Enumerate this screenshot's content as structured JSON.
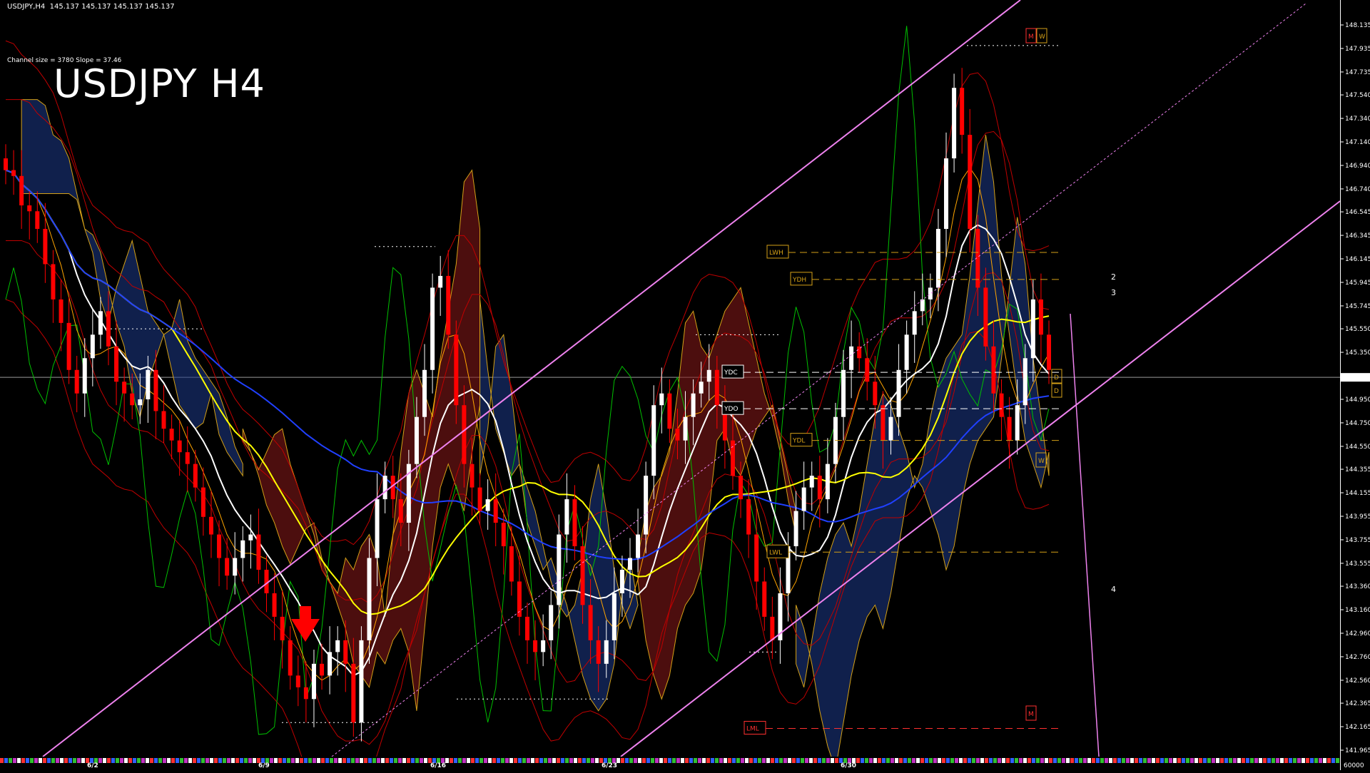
{
  "header": {
    "symbol_info": "USDJPY,H4",
    "ohlc": "145.137 145.137 145.137 145.137",
    "channel_info": "Channel size = 3780  Slope = 37.46",
    "title": "USDJPY H4"
  },
  "chart_data": {
    "type": "candlestick",
    "title": "USDJPY H4",
    "timeframe": "H4",
    "current_price": "145.137",
    "y_axis": {
      "min": 141.965,
      "max": 148.135,
      "ticks": [
        "148.135",
        "147.935",
        "147.735",
        "147.540",
        "147.340",
        "147.140",
        "146.940",
        "146.740",
        "146.545",
        "146.345",
        "146.145",
        "145.945",
        "145.745",
        "145.550",
        "145.350",
        "145.150",
        "144.950",
        "144.750",
        "144.550",
        "144.355",
        "144.155",
        "143.955",
        "143.755",
        "143.555",
        "143.360",
        "143.160",
        "142.960",
        "142.760",
        "142.560",
        "142.365",
        "142.165",
        "141.965"
      ],
      "bottom_label": "60000"
    },
    "x_axis": {
      "date_labels": [
        "6/2",
        "6/9",
        "6/16",
        "6/23",
        "6/30"
      ]
    },
    "candles_close_path": [
      146.9,
      146.85,
      146.6,
      146.55,
      146.4,
      146.1,
      145.8,
      145.6,
      145.2,
      145.0,
      145.3,
      145.5,
      145.7,
      145.4,
      145.1,
      145.0,
      144.9,
      144.95,
      145.2,
      144.85,
      144.7,
      144.6,
      144.5,
      144.4,
      144.2,
      143.95,
      143.8,
      143.6,
      143.45,
      143.6,
      143.75,
      143.8,
      143.5,
      143.3,
      143.1,
      142.9,
      142.6,
      142.5,
      142.4,
      142.7,
      142.6,
      142.8,
      142.9,
      142.7,
      142.2,
      142.9,
      143.6,
      144.1,
      144.3,
      144.1,
      143.9,
      144.4,
      144.8,
      145.2,
      145.9,
      146.0,
      145.5,
      144.9,
      144.4,
      144.2,
      144.0,
      144.1,
      143.9,
      143.7,
      143.4,
      143.1,
      142.9,
      142.8,
      142.9,
      143.2,
      143.8,
      144.1,
      143.7,
      143.2,
      142.9,
      142.7,
      142.9,
      143.3,
      143.5,
      143.6,
      143.8,
      144.3,
      144.9,
      145.0,
      144.7,
      144.6,
      144.8,
      145.0,
      145.1,
      145.2,
      144.9,
      144.6,
      144.3,
      144.1,
      143.8,
      143.4,
      143.1,
      142.9,
      143.3,
      143.7,
      144.0,
      144.2,
      144.3,
      144.1,
      144.4,
      144.8,
      145.2,
      145.4,
      145.3,
      145.1,
      144.9,
      144.6,
      144.8,
      145.2,
      145.5,
      145.7,
      145.8,
      145.9,
      146.4,
      147.0,
      147.6,
      147.2,
      146.4,
      145.9,
      145.4,
      145.0,
      144.8,
      144.6,
      144.9,
      145.3,
      145.8,
      145.5,
      145.2
    ],
    "levels": [
      {
        "label": "LWH",
        "price": 146.2,
        "color": "#d4a017"
      },
      {
        "label": "YDH",
        "price": 145.97,
        "color": "#d4a017"
      },
      {
        "label": "YDC",
        "price": 145.18,
        "color": "#ffffff"
      },
      {
        "label": "YDO",
        "price": 144.87,
        "color": "#ffffff"
      },
      {
        "label": "YDL",
        "price": 144.6,
        "color": "#d4a017"
      },
      {
        "label": "LWL",
        "price": 143.65,
        "color": "#d4a017"
      },
      {
        "label": "LML",
        "price": 142.15,
        "color": "#ff3030"
      }
    ],
    "markers": [
      {
        "label": "M",
        "color": "#ff3030"
      },
      {
        "label": "W",
        "color": "#d4a017"
      },
      {
        "label": "D",
        "color": "#d4a017"
      },
      {
        "label": "D",
        "color": "#d4a017"
      },
      {
        "label": "W",
        "color": "#d4a017"
      },
      {
        "label": "M",
        "color": "#ff3030"
      }
    ],
    "projection_labels": [
      "2",
      "3",
      "4"
    ],
    "colors": {
      "bull_candle": "#ffffff",
      "bear_candle": "#ff0000",
      "channel": "#ee82ee",
      "ma_white": "#ffffff",
      "ma_yellow": "#ffff00",
      "ma_blue": "#2040ff",
      "green_line": "#00c000",
      "bollinger": "#c00000",
      "cloud_red": "#8b1a1a",
      "cloud_blue": "#1e3a8a"
    }
  }
}
